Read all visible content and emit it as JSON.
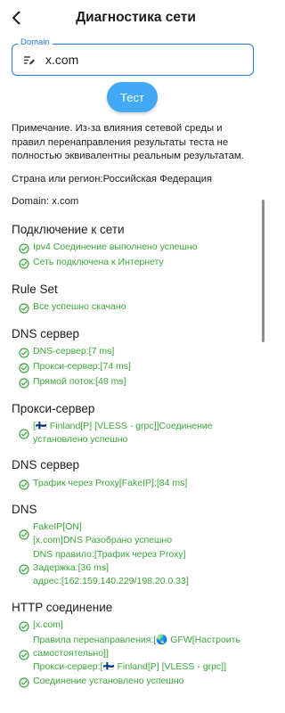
{
  "header": {
    "title": "Диагностика сети"
  },
  "domain_input": {
    "label": "Domain",
    "value": "x.com"
  },
  "test_button": {
    "label": "Тест"
  },
  "note": "Примечание. Из-за влияния сетевой среды и правил перенаправления результаты теста не полностью эквивалентны реальным результатам.",
  "country": "Страна или регион:Российская Федерация",
  "domain_info": "Domain: x.com",
  "sections": [
    {
      "title": "Подключение к сети",
      "rows": [
        [
          "Ipv4 Соединение выполнено успешно"
        ],
        [
          "Сеть подключена к Интернету"
        ]
      ]
    },
    {
      "title": "Rule Set",
      "rows": [
        [
          "Все успешно скачано"
        ]
      ]
    },
    {
      "title": "DNS сервер",
      "rows": [
        [
          "DNS-сервер:[7 ms]"
        ],
        [
          "Прокси-сервер:[74 ms]"
        ],
        [
          "Прямой поток:[48 ms]"
        ]
      ]
    },
    {
      "title": "Прокси-сервер",
      "rows": [
        [
          "[🇫🇮 Finland[P] [VLESS - grpc]]Соединение",
          "установлено успешно"
        ]
      ]
    },
    {
      "title": "DNS сервер",
      "rows": [
        [
          "Трафик через Proxy[FakeIP]:[84 ms]"
        ]
      ]
    },
    {
      "title": "DNS",
      "rows": [
        [
          "FakeIP[ON]",
          "[x.com]DNS Разобрано успешно"
        ],
        [
          "DNS правило:[Трафик через Proxy]",
          "Задержка:[36 ms]",
          "адрес:[162.159.140.229/198.20.0.33]"
        ]
      ]
    },
    {
      "title": "HTTP соединение",
      "rows": [
        [
          "[x.com]"
        ],
        [
          "Правила перенаправления:[🌏 GFW[Настроить",
          "самостоятельно]]",
          "Прокси-сервер:[🇫🇮 Finland[P] [VLESS - grpc]]"
        ],
        [
          "Соединение установлено успешно"
        ]
      ]
    }
  ],
  "colors": {
    "accent": "#2a73f0",
    "button": "#42a9f6",
    "success": "#3aa63a",
    "text": "#1c1c1e"
  },
  "icons": {
    "back": "arrow-left-icon",
    "domain": "edit-list-icon",
    "status": "check-circle-icon"
  }
}
